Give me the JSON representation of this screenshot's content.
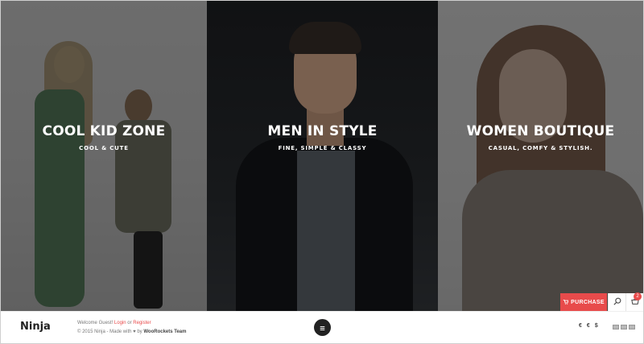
{
  "panels": [
    {
      "title": "COOL KID ZONE",
      "subtitle": "COOL & CUTE"
    },
    {
      "title": "MEN IN STYLE",
      "subtitle": "FINE, SIMPLE & CLASSY"
    },
    {
      "title": "WOMEN BOUTIQUE",
      "subtitle": "CASUAL, COMFY & STYLISH."
    }
  ],
  "actions": {
    "purchase_label": "PURCHASE",
    "cart_count": "2"
  },
  "footer": {
    "logo": "Ninja",
    "welcome_prefix": "Welcome Guest!",
    "login_label": "Login",
    "or_text": "or",
    "register_label": "Register",
    "copyright_prefix": "© 2015 Ninja - Made with ♥ by",
    "credit": "WooRockets Team",
    "currencies": [
      "€",
      "€",
      "$"
    ]
  },
  "colors": {
    "accent": "#e84b4b",
    "dark": "#222222"
  }
}
